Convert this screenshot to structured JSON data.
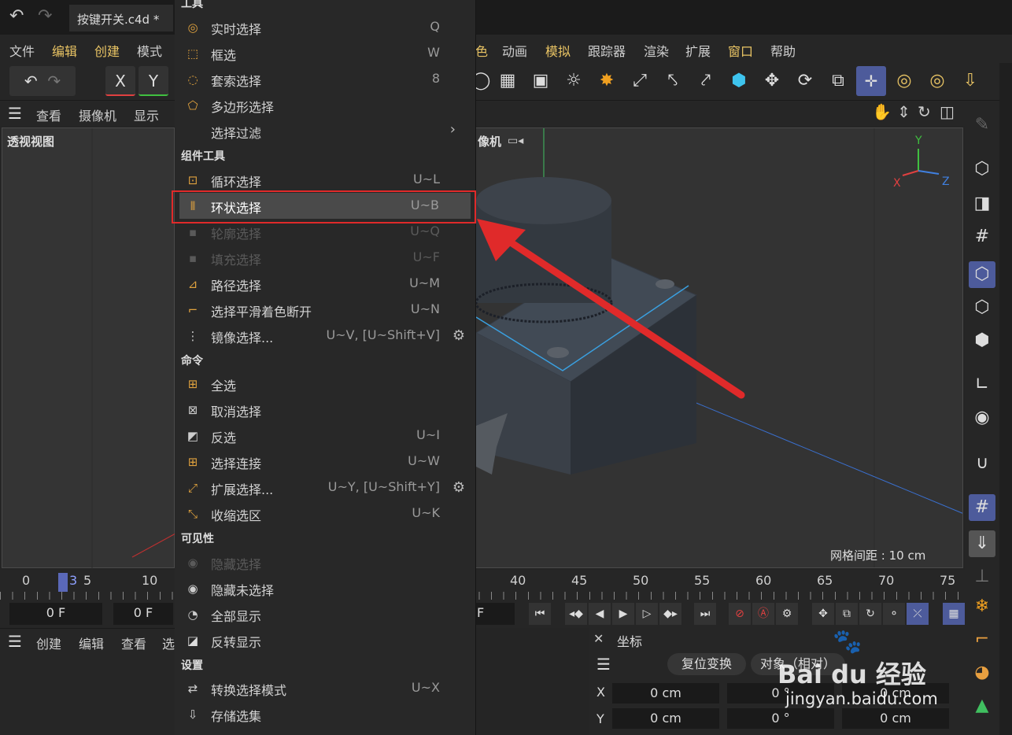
{
  "title_bar": {
    "file_tab": "按键开关.c4d *"
  },
  "menu_bar": {
    "left": [
      "文件",
      "编辑",
      "创建",
      "模式"
    ],
    "right": [
      "色",
      "动画",
      "模拟",
      "跟踪器",
      "渲染",
      "扩展",
      "窗口",
      "帮助"
    ]
  },
  "toolbar": {
    "x_label": "X",
    "y_label": "Y"
  },
  "viewport_left": {
    "header": [
      "查看",
      "摄像机",
      "显示"
    ],
    "label": "透视视图"
  },
  "viewport_main": {
    "camera_label": "像机",
    "grid_spacing": "网格间距 : 10 cm",
    "axis_x": "X",
    "axis_y": "Y",
    "axis_z": "Z"
  },
  "timeline": {
    "ticks": [
      "0",
      "3",
      "5",
      "10",
      "40",
      "45",
      "50",
      "55",
      "60",
      "65",
      "70",
      "75"
    ],
    "frame_start": "0 F",
    "frame_current": "0 F",
    "frame_end": "F"
  },
  "object_panel": {
    "menu": [
      "创建",
      "编辑",
      "查看",
      "选"
    ]
  },
  "coord_panel": {
    "title": "坐标",
    "reset_button": "复位变换",
    "mode_button": "对象（相对）",
    "rows": [
      {
        "axis": "X",
        "pos": "0 cm",
        "rot": "0 °",
        "scale": "0 cm"
      },
      {
        "axis": "Y",
        "pos": "0 cm",
        "rot": "0 °",
        "scale": "0 cm"
      }
    ]
  },
  "dropdown": {
    "section_tools": "工具",
    "items_tools": [
      {
        "label": "实时选择",
        "shortcut": "Q",
        "icon": "live-select-icon"
      },
      {
        "label": "框选",
        "shortcut": "W",
        "icon": "box-select-icon"
      },
      {
        "label": "套索选择",
        "shortcut": "8",
        "icon": "lasso-select-icon"
      },
      {
        "label": "多边形选择",
        "shortcut": "",
        "icon": "polygon-select-icon"
      },
      {
        "label": "选择过滤",
        "shortcut": "",
        "icon": ""
      }
    ],
    "section_component": "组件工具",
    "items_component": [
      {
        "label": "循环选择",
        "shortcut": "U~L"
      },
      {
        "label": "环状选择",
        "shortcut": "U~B"
      },
      {
        "label": "轮廓选择",
        "shortcut": "U~Q"
      },
      {
        "label": "填充选择",
        "shortcut": "U~F"
      },
      {
        "label": "路径选择",
        "shortcut": "U~M"
      },
      {
        "label": "选择平滑着色断开",
        "shortcut": "U~N"
      },
      {
        "label": "镜像选择...",
        "shortcut": "U~V, [U~Shift+V]"
      }
    ],
    "section_commands": "命令",
    "items_commands": [
      {
        "label": "全选",
        "shortcut": ""
      },
      {
        "label": "取消选择",
        "shortcut": ""
      },
      {
        "label": "反选",
        "shortcut": "U~I"
      },
      {
        "label": "选择连接",
        "shortcut": "U~W"
      },
      {
        "label": "扩展选择...",
        "shortcut": "U~Y, [U~Shift+Y]"
      },
      {
        "label": "收缩选区",
        "shortcut": "U~K"
      }
    ],
    "section_visibility": "可见性",
    "items_visibility": [
      {
        "label": "隐藏选择",
        "shortcut": ""
      },
      {
        "label": "隐藏未选择",
        "shortcut": ""
      },
      {
        "label": "全部显示",
        "shortcut": ""
      },
      {
        "label": "反转显示",
        "shortcut": ""
      }
    ],
    "section_settings": "设置",
    "items_settings": [
      {
        "label": "转换选择模式",
        "shortcut": "U~X"
      },
      {
        "label": "存储选集",
        "shortcut": ""
      }
    ]
  },
  "watermark": {
    "brand": "Bai du 经验",
    "url": "jingyan.baidu.com"
  },
  "colors": {
    "highlight_box": "#e02a2a",
    "accent_yellow": "#e9c464",
    "selected_tool": "#4d5b9b",
    "arrow": "#e02a2a"
  }
}
